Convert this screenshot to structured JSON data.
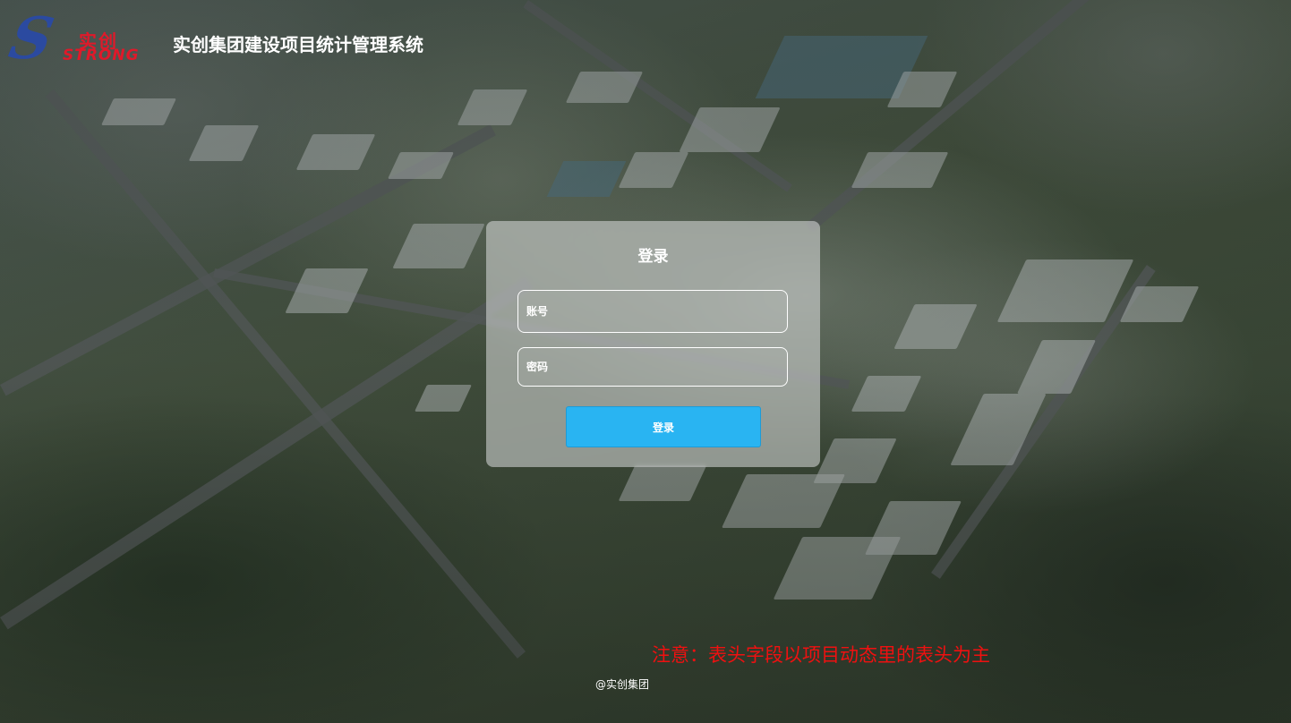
{
  "header": {
    "logo_cn": "实创",
    "logo_en": "STRONG",
    "title": "实创集团建设项目统计管理系统"
  },
  "login": {
    "title": "登录",
    "account_placeholder": "账号",
    "password_placeholder": "密码",
    "submit_label": "登录"
  },
  "notice": "注意：表头字段以项目动态里的表头为主",
  "footer": "@实创集团",
  "colors": {
    "brand_blue": "#2b4aa0",
    "brand_red": "#e0192a",
    "button": "#29b4f2",
    "notice": "#f01010"
  }
}
